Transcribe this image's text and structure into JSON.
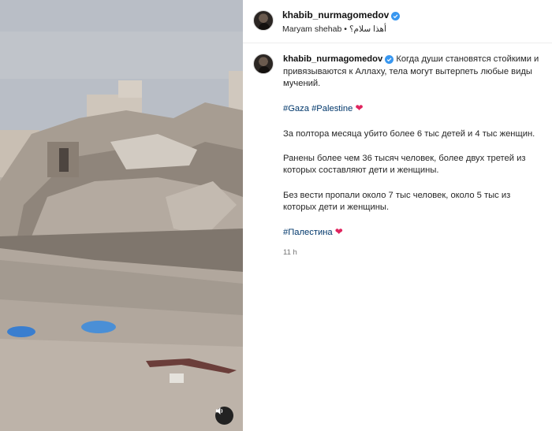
{
  "header": {
    "username": "khabib_nurmagomedov",
    "subline_user": "Maryam shehab",
    "subline_separator": "•",
    "subline_audio": "أهذا سلام؟"
  },
  "post": {
    "username": "khabib_nurmagomedov",
    "line1": "Когда души становятся стойкими и привязываются к Аллаху, тела могут вытерпеть любые виды мучений.",
    "tag1": "#Gaza",
    "tag2": "#Palestine",
    "para2": "За полтора месяца убито более 6 тыс детей и 4 тыс женщин.",
    "para3": "Ранены более чем 36 тысяч человек, более двух третей из которых составляют дети и женщины.",
    "para4": "Без вести пропали около 7 тыс человек, около 5 тыс из которых дети и женщины.",
    "tag3": "#Палестина",
    "time": "11 h"
  },
  "icons": {
    "verified": "verified-badge-icon",
    "heart": "red-heart-emoji",
    "sound": "speaker-icon"
  },
  "colors": {
    "verified": "#3897f0",
    "hashtag": "#00376b",
    "heart": "#e0245e"
  }
}
